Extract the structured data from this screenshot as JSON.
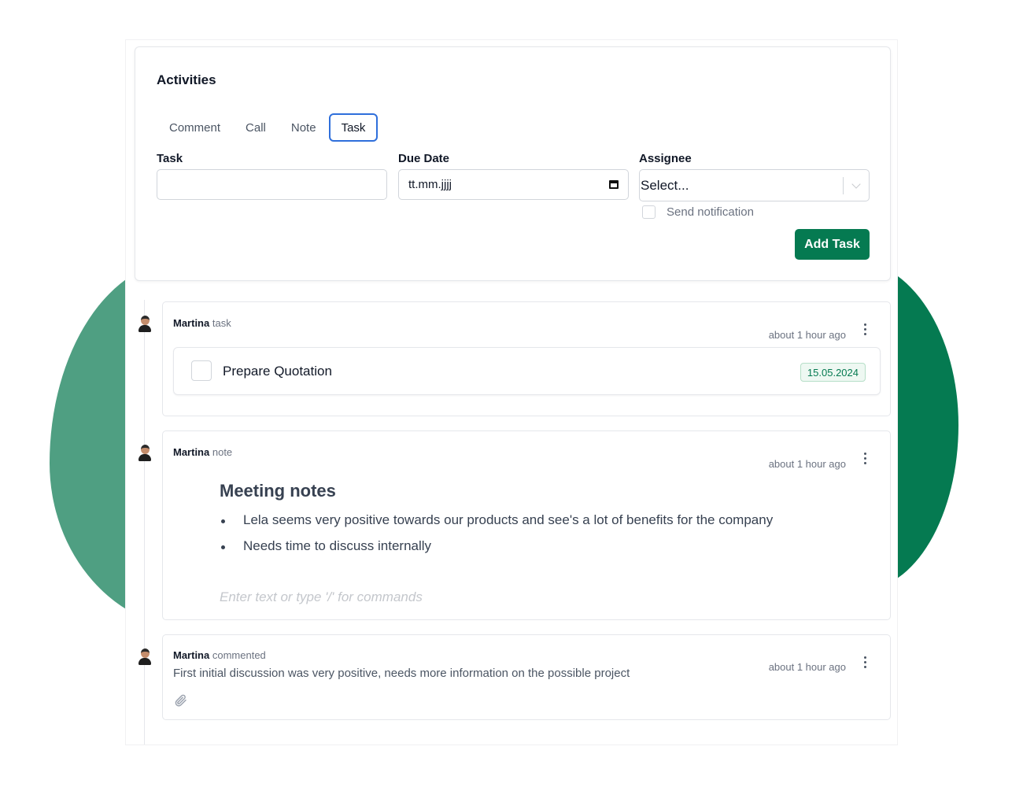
{
  "activities": {
    "title": "Activities",
    "tabs": [
      "Comment",
      "Call",
      "Note",
      "Task"
    ],
    "active_tab": "Task",
    "form": {
      "task_label": "Task",
      "task_value": "",
      "due_label": "Due Date",
      "due_value": "tt.mm.jjjj",
      "assignee_label": "Assignee",
      "assignee_value": "Select...",
      "notify_label": "Send notification",
      "notify_checked": false,
      "add_button": "Add Task"
    }
  },
  "timeline": [
    {
      "author": "Martina",
      "action": "task",
      "time": "about 1 hour ago",
      "task_title": "Prepare Quotation",
      "task_date": "15.05.2024",
      "done": false
    },
    {
      "author": "Martina",
      "action": "note",
      "time": "about 1 hour ago",
      "heading": "Meeting notes",
      "bullets": [
        "Lela seems very positive towards our products and see's a lot of benefits for the company",
        "Needs time to discuss internally"
      ],
      "placeholder": "Enter text or type '/' for commands"
    },
    {
      "author": "Martina",
      "action": "commented",
      "time": "about 1 hour ago",
      "text": "First initial discussion was very positive, needs more information on the possible project"
    }
  ],
  "colors": {
    "brand_green": "#057a51",
    "blob_light": "#4f9f82",
    "tab_active_border": "#2f6fdb"
  },
  "icons": [
    "calendar-icon",
    "chevron-down-icon",
    "more-vertical-icon",
    "paperclip-icon",
    "avatar"
  ]
}
